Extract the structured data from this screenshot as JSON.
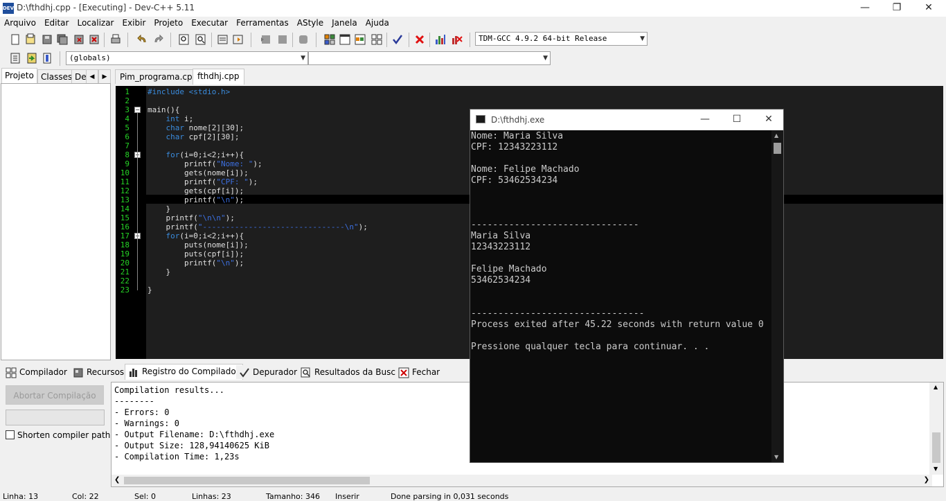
{
  "window": {
    "title": "D:\\fthdhj.cpp - [Executing] - Dev-C++ 5.11",
    "icon_label": "DEV"
  },
  "menu": [
    "Arquivo",
    "Editar",
    "Localizar",
    "Exibir",
    "Projeto",
    "Executar",
    "Ferramentas",
    "AStyle",
    "Janela",
    "Ajuda"
  ],
  "toolbar": {
    "compiler": "TDM-GCC 4.9.2 64-bit Release",
    "scope": "(globals)",
    "scope2": ""
  },
  "left_tabs": [
    "Projeto",
    "Classes",
    "De"
  ],
  "editor_tabs": [
    "Pim_programa.cpp",
    "fthdhj.cpp"
  ],
  "code_lines": [
    "#include <stdio.h>",
    "",
    "main(){",
    "    int i;",
    "    char nome[2][30];",
    "    char cpf[2][30];",
    "",
    "    for(i=0;i<2;i++){",
    "        printf(\"Nome: \");",
    "        gets(nome[i]);",
    "        printf(\"CPF: \");",
    "        gets(cpf[i]);",
    "        printf(\"\\n\");",
    "    }",
    "    printf(\"\\n\\n\");",
    "    printf(\"-------------------------------\\n\");",
    "    for(i=0;i<2;i++){",
    "        puts(nome[i]);",
    "        puts(cpf[i]);",
    "        printf(\"\\n\");",
    "    }",
    "",
    "}"
  ],
  "bottom_tabs": [
    "Compilador",
    "Recursos",
    "Registro do Compilador",
    "Depurador",
    "Resultados da Busca",
    "Fechar"
  ],
  "abort_button": "Abortar Compilação",
  "shorten_label": "Shorten compiler paths",
  "log_lines": [
    "Compilation results...",
    "--------",
    "- Errors: 0",
    "- Warnings: 0",
    "- Output Filename: D:\\fthdhj.exe",
    "- Output Size: 128,94140625 KiB",
    "- Compilation Time: 1,23s"
  ],
  "status": {
    "linha": "Linha:   13",
    "col": "Col:   22",
    "sel": "Sel:   0",
    "linhas": "Linhas:   23",
    "tamanho": "Tamanho:   346",
    "mode": "Inserir",
    "message": "Done parsing in 0,031 seconds"
  },
  "console": {
    "title": "D:\\fthdhj.exe",
    "output": [
      "Nome: Maria Silva",
      "CPF: 12343223112",
      "",
      "Nome: Felipe Machado",
      "CPF: 53462534234",
      "",
      "",
      "",
      "-------------------------------",
      "Maria Silva",
      "12343223112",
      "",
      "Felipe Machado",
      "53462534234",
      "",
      "",
      "--------------------------------",
      "Process exited after 45.22 seconds with return value 0",
      "",
      "Pressione qualquer tecla para continuar. . ."
    ]
  }
}
